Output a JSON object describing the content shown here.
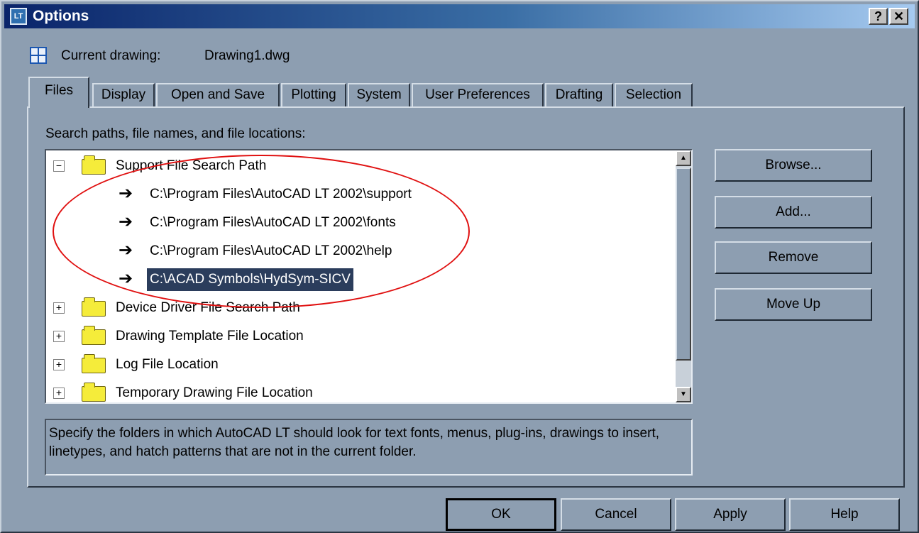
{
  "window": {
    "title": "Options",
    "app_icon": "LT",
    "help_label": "?",
    "close_label": "✕"
  },
  "current_drawing": {
    "label": "Current drawing:",
    "value": "Drawing1.dwg"
  },
  "tabs": [
    {
      "label": "Files",
      "active": true
    },
    {
      "label": "Display"
    },
    {
      "label": "Open and Save"
    },
    {
      "label": "Plotting"
    },
    {
      "label": "System"
    },
    {
      "label": "User Preferences"
    },
    {
      "label": "Drafting"
    },
    {
      "label": "Selection"
    }
  ],
  "files": {
    "section_label": "Search paths, file names, and file locations:",
    "tree": [
      {
        "label": "Support File Search Path",
        "expanded": true,
        "children": [
          {
            "label": "C:\\Program Files\\AutoCAD LT 2002\\support"
          },
          {
            "label": "C:\\Program Files\\AutoCAD LT 2002\\fonts"
          },
          {
            "label": "C:\\Program Files\\AutoCAD LT 2002\\help"
          },
          {
            "label": "C:\\ACAD Symbols\\HydSym-SICV",
            "selected": true
          }
        ]
      },
      {
        "label": "Device Driver File Search Path",
        "expanded": false
      },
      {
        "label": "Drawing Template File Location",
        "expanded": false
      },
      {
        "label": "Log File Location",
        "expanded": false
      },
      {
        "label": "Temporary Drawing File Location",
        "expanded": false
      }
    ],
    "description": "Specify the folders in which AutoCAD LT should look for text fonts, menus, plug-ins, drawings to insert, linetypes, and hatch patterns that are not in the current folder.",
    "buttons": {
      "browse": "Browse...",
      "add": "Add...",
      "remove": "Remove",
      "move_up": "Move Up"
    }
  },
  "footer": {
    "ok": "OK",
    "cancel": "Cancel",
    "apply": "Apply",
    "help": "Help"
  },
  "colors": {
    "dialog_bg": "#8d9eb1",
    "title_start": "#0a246a",
    "title_end": "#a6caf0",
    "selection": "#2b3d5c",
    "annotation": "#e01010"
  }
}
